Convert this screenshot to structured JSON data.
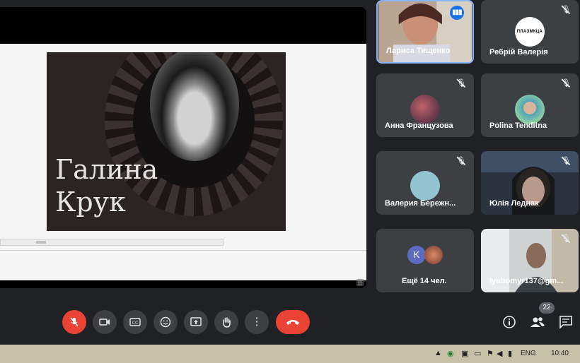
{
  "presentation": {
    "slide_title_line1": "Галина",
    "slide_title_line2": "Крук"
  },
  "participants": [
    {
      "name": "Лариса Тищенко",
      "state": "speaking"
    },
    {
      "name": "Ребрій Валерія",
      "state": "muted",
      "logo_text": "ПЛАЗМКЦА"
    },
    {
      "name": "Анна Французова",
      "state": "muted"
    },
    {
      "name": "Polina Tenditna",
      "state": "muted"
    },
    {
      "name": "Валерия Бережн...",
      "state": "muted"
    },
    {
      "name": "Юлія Леднак",
      "state": "muted"
    },
    {
      "name": "Ещё 14 чел.",
      "avatar_letter": "K"
    },
    {
      "name": "lyubomyr137@gm...",
      "state": "muted"
    }
  ],
  "controls": {
    "people_count": "22"
  },
  "colors": {
    "background": "#202124",
    "tile": "#3c4043",
    "accent_blue": "#1a73e8",
    "danger_red": "#ea4335"
  },
  "taskbar": {
    "language": "ENG",
    "time": "10:40"
  }
}
